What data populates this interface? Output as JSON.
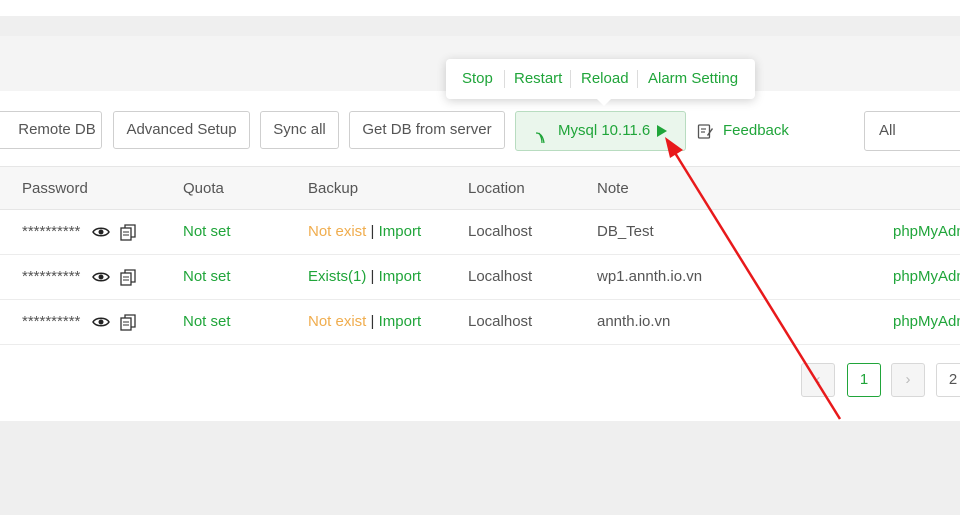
{
  "toolbar": {
    "remote_db": "Remote DB",
    "advanced_setup": "Advanced Setup",
    "sync_all": "Sync all",
    "get_db": "Get DB from server",
    "mysql_version": "Mysql 10.11.6",
    "feedback": "Feedback",
    "filter_value": "All"
  },
  "mysql_menu": {
    "stop": "Stop",
    "restart": "Restart",
    "reload": "Reload",
    "alarm_setting": "Alarm Setting"
  },
  "table": {
    "headers": {
      "password": "Password",
      "quota": "Quota",
      "backup": "Backup",
      "location": "Location",
      "note": "Note"
    },
    "rows": [
      {
        "password": "**********",
        "quota": "Not set",
        "backup_status": "Not exist",
        "backup_sep": "|",
        "import": "Import",
        "location": "Localhost",
        "note": "DB_Test",
        "action": "phpMyAdmin"
      },
      {
        "password": "**********",
        "quota": "Not set",
        "backup_status": "Exists(1)",
        "backup_sep": "|",
        "import": "Import",
        "location": "Localhost",
        "note": "wp1.annth.io.vn",
        "action": "phpMyAdmin"
      },
      {
        "password": "**********",
        "quota": "Not set",
        "backup_status": "Not exist",
        "backup_sep": "|",
        "import": "Import",
        "location": "Localhost",
        "note": "annth.io.vn",
        "action": "phpMyAdmin"
      }
    ]
  },
  "pagination": {
    "prev": "‹",
    "current": "1",
    "next": "›",
    "page2": "2"
  },
  "colors": {
    "accent": "#20a53a",
    "warning": "#f0ad4e",
    "annotation_arrow": "#e8191b"
  },
  "icons": [
    "mysql-leaf-icon",
    "play-icon",
    "feedback-edit-icon",
    "eye-icon",
    "copy-icon"
  ]
}
